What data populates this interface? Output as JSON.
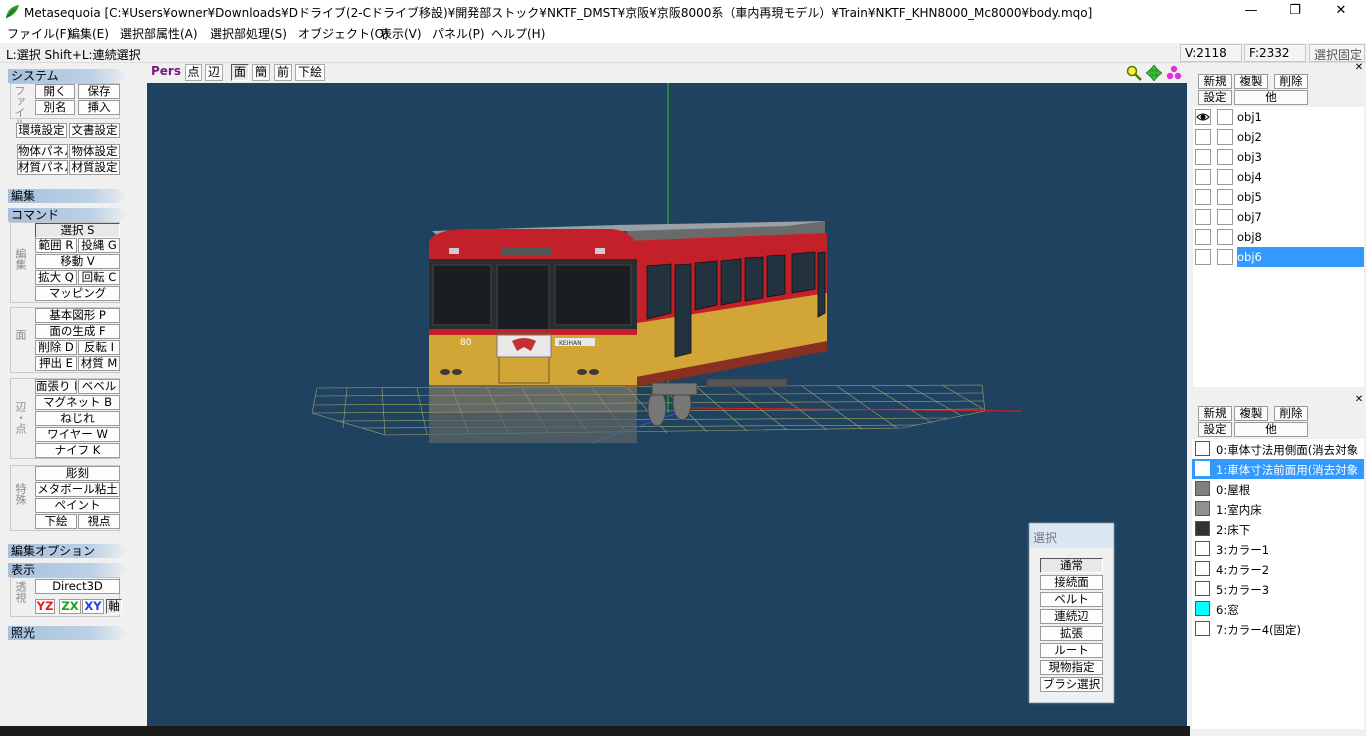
{
  "window": {
    "title": "Metasequoia [C:¥Users¥owner¥Downloads¥Dドライブ(2-Cドライブ移設)¥開発部ストック¥NKTF_DMST¥京阪¥京阪8000系（車内再現モデル）¥Train¥NKTF_KHN8000_Mc8000¥body.mqo]",
    "minimize": "—",
    "maximize": "❐",
    "close": "✕"
  },
  "menu": [
    "ファイル(F)",
    "編集(E)",
    "選択部属性(A)",
    "選択部処理(S)",
    "オブジェクト(O)",
    "表示(V)",
    "パネル(P)",
    "ヘルプ(H)"
  ],
  "status": {
    "hint": "L:選択  Shift+L:連続選択",
    "vertices": "V:2118",
    "faces": "F:2332",
    "lock": "選択固定"
  },
  "left": {
    "system": "システム",
    "file_group": "ファイル",
    "open": "開く",
    "save": "保存",
    "rename": "別名",
    "insert": "挿入",
    "env": "環境設定",
    "doc": "文書設定",
    "obj_panel": "物体パネル",
    "obj_settings": "物体設定",
    "mat_panel": "材質パネル",
    "mat_settings": "材質設定",
    "edit": "編集",
    "command": "コマンド",
    "edit_group": "編集",
    "select": "選択 S",
    "range": "範囲 R",
    "lasso": "投縄 G",
    "move": "移動 V",
    "scale": "拡大 Q",
    "rotate": "回転 C",
    "mapping": "マッピング",
    "face_group": "面",
    "primitive": "基本図形 P",
    "make_face": "面の生成 F",
    "delete": "削除 D",
    "flip": "反転 I",
    "extrude": "押出 E",
    "material": "材質 M",
    "edge_group": "辺・点",
    "stretch": "面張り H",
    "bevel": "ベベル",
    "magnet": "マグネット B",
    "twist": "ねじれ",
    "wire": "ワイヤー W",
    "knife": "ナイフ K",
    "special_group": "特殊",
    "carve": "彫刻",
    "metaball": "メタボール粘土",
    "paint": "ペイント",
    "underlay": "下絵",
    "view": "視点",
    "edit_options": "編集オプション",
    "display": "表示",
    "persp_group": "透視",
    "direct3d": "Direct3D",
    "yz": "YZ",
    "zx": "ZX",
    "xy": "XY",
    "axis": "軸",
    "lighting": "照光"
  },
  "viewport": {
    "pers": "Pers",
    "point": "点",
    "edge": "辺",
    "face": "面",
    "simple": "簡",
    "front": "前",
    "underlay": "下絵",
    "colors": {
      "bg": "#1f4260",
      "grid": "#b8b66a",
      "red_axis": "#d82020",
      "green_axis": "#20c020"
    }
  },
  "selection_palette": {
    "title": "選択",
    "items": [
      "通常",
      "接続面",
      "ベルト",
      "連続辺",
      "拡張",
      "ルート",
      "現物指定",
      "ブラシ選択"
    ]
  },
  "objects": {
    "new": "新規",
    "copy": "複製",
    "delete": "削除",
    "settings": "設定",
    "other": "他",
    "items": [
      "obj1",
      "obj2",
      "obj3",
      "obj4",
      "obj5",
      "obj7",
      "obj8",
      "obj6"
    ],
    "selected": "obj6"
  },
  "materials": {
    "new": "新規",
    "copy": "複製",
    "delete": "削除",
    "settings": "設定",
    "other": "他",
    "items": [
      {
        "name": "0:車体寸法用側面(消去対象",
        "color": "#ffffff"
      },
      {
        "name": "1:車体寸法前面用(消去対象",
        "color": "#ffffff"
      },
      {
        "name": "0:屋根",
        "color": "#808080"
      },
      {
        "name": "1:室内床",
        "color": "#909090"
      },
      {
        "name": "2:床下",
        "color": "#333333"
      },
      {
        "name": "3:カラー1",
        "color": "#ffffff"
      },
      {
        "name": "4:カラー2",
        "color": "#ffffff"
      },
      {
        "name": "5:カラー3",
        "color": "#ffffff"
      },
      {
        "name": "6:窓",
        "color": "#00ffff"
      },
      {
        "name": "7:カラー4(固定)",
        "color": "#ffffff"
      }
    ]
  },
  "train": {
    "number": "80",
    "logo_text": "KEIHAN"
  }
}
